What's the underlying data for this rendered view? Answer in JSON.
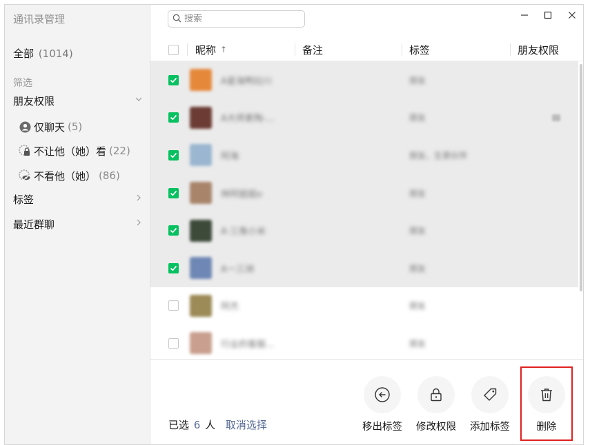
{
  "sidebar": {
    "app_title": "通讯录管理",
    "all_label": "全部",
    "all_count": "(1014)",
    "filter_title": "筛选",
    "friend_permission_group": "朋友权限",
    "permission_items": [
      {
        "label": "仅聊天",
        "count": "(5)",
        "icon": "person-icon"
      },
      {
        "label": "不让他（她）看",
        "count": "(22)",
        "icon": "lock-icon"
      },
      {
        "label": "不看他（她）",
        "count": "(86)",
        "icon": "eye-off-icon"
      }
    ],
    "tags_group": "标签",
    "recent_groups_group": "最近群聊"
  },
  "search": {
    "placeholder": "搜索"
  },
  "table": {
    "columns": {
      "nickname": "昵称",
      "sort_indicator": "↑",
      "remark": "备注",
      "tags": "标签",
      "friend_permission": "朋友权限"
    },
    "rows": [
      {
        "selected": true,
        "nickname": "A星海鸭拉川",
        "tag": "朋友",
        "avatar_color": "#e5883a",
        "has_extra_icon": false
      },
      {
        "selected": true,
        "nickname": "A大师素陶-...",
        "tag": "朋友",
        "avatar_color": "#6b3b34",
        "has_extra_icon": true
      },
      {
        "selected": true,
        "nickname": "阿海",
        "tag": "朋友、生意伙伴",
        "avatar_color": "#9ab6d0",
        "has_extra_icon": false
      },
      {
        "selected": true,
        "nickname": "林阿姐姐o",
        "tag": "朋友",
        "avatar_color": "#a8846b",
        "has_extra_icon": false
      },
      {
        "selected": true,
        "nickname": "A·三角小米",
        "tag": "朋友",
        "avatar_color": "#3d4a3a",
        "has_extra_icon": false
      },
      {
        "selected": true,
        "nickname": "A一三洲",
        "tag": "朋友",
        "avatar_color": "#6f87b4",
        "has_extra_icon": false
      },
      {
        "selected": false,
        "nickname": "阿杰",
        "tag": "朋友",
        "avatar_color": "#9c8a57",
        "has_extra_icon": false
      },
      {
        "selected": false,
        "nickname": "行业的客服...",
        "tag": "朋友",
        "avatar_color": "#c9a08f",
        "has_extra_icon": false
      }
    ]
  },
  "footer": {
    "selected_prefix": "已选",
    "selected_count": "6",
    "selected_suffix": "人",
    "cancel_selection": "取消选择",
    "actions": [
      {
        "label": "移出标签",
        "icon": "arrow-left-circle-icon"
      },
      {
        "label": "修改权限",
        "icon": "lock-icon"
      },
      {
        "label": "添加标签",
        "icon": "tag-icon"
      },
      {
        "label": "删除",
        "icon": "trash-icon"
      }
    ]
  },
  "colors": {
    "accent_green": "#07c160",
    "link_blue": "#576b95",
    "highlight_red": "#e02020"
  }
}
